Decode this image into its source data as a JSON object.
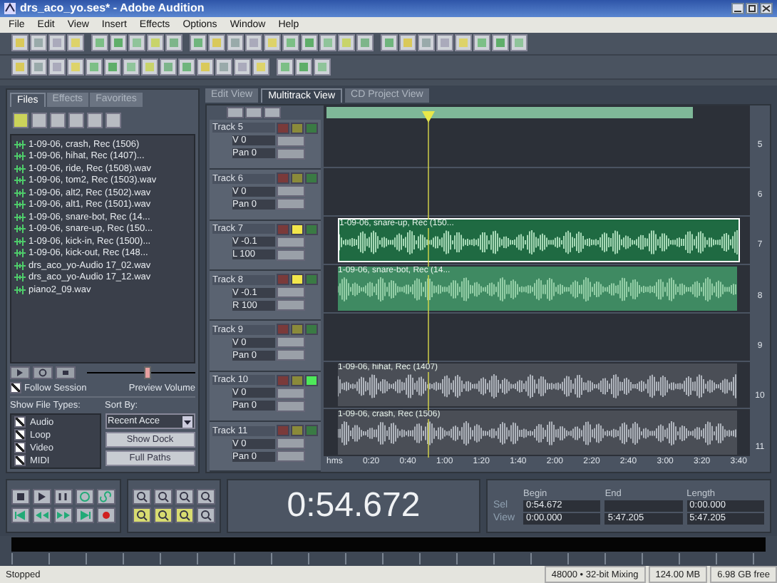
{
  "window": {
    "title": "drs_aco_yo.ses* - Adobe Audition"
  },
  "menu": [
    "File",
    "Edit",
    "View",
    "Insert",
    "Effects",
    "Options",
    "Window",
    "Help"
  ],
  "file_panel": {
    "tabs": [
      {
        "label": "Files",
        "selected": true
      },
      {
        "label": "Effects",
        "selected": false
      },
      {
        "label": "Favorites",
        "selected": false
      }
    ],
    "files": [
      "1-09-06, crash, Rec (1506)",
      "1-09-06, hihat, Rec (1407)...",
      "1-09-06, ride, Rec (1508).wav",
      "1-09-06, tom2, Rec (1503).wav",
      "1-09-06, alt2, Rec (1502).wav",
      "1-09-06, alt1, Rec (1501).wav",
      "1-09-06, snare-bot, Rec (14...",
      "1-09-06, snare-up, Rec (150...",
      "1-09-06, kick-in, Rec (1500)...",
      "1-09-06, kick-out, Rec (148...",
      "drs_aco_yo-Audio 17_02.wav",
      "drs_aco_yo-Audio 17_12.wav",
      "piano2_09.wav"
    ],
    "follow_session": {
      "label": "Follow Session",
      "checked": true
    },
    "preview_volume": {
      "label": "Preview Volume",
      "level": 0.55
    },
    "show_file_types": {
      "label": "Show File Types:",
      "types": [
        {
          "label": "Audio",
          "checked": true
        },
        {
          "label": "Loop",
          "checked": true
        },
        {
          "label": "Video",
          "checked": true
        },
        {
          "label": "MIDI",
          "checked": true
        }
      ]
    },
    "sort_by": {
      "label": "Sort By:",
      "value": "Recent Acce"
    },
    "buttons": [
      "Show Dock",
      "Full Paths"
    ]
  },
  "views": [
    {
      "label": "Edit View",
      "selected": false
    },
    {
      "label": "Multitrack View",
      "selected": true
    },
    {
      "label": "CD Project View",
      "selected": false
    }
  ],
  "tracks": [
    {
      "name": "Track 5",
      "number": "5",
      "mute": false,
      "solo": false,
      "record": false,
      "volume": "V 0",
      "pan": "Pan 0"
    },
    {
      "name": "Track 6",
      "number": "6",
      "mute": false,
      "solo": false,
      "record": false,
      "volume": "V 0",
      "pan": "Pan 0"
    },
    {
      "name": "Track 7",
      "number": "7",
      "mute": false,
      "solo": true,
      "record": false,
      "volume": "V -0.1",
      "pan": "L 100",
      "clip": {
        "label": "1-09-06, snare-up, Rec (150...",
        "selected": true
      }
    },
    {
      "name": "Track 8",
      "number": "8",
      "mute": false,
      "solo": true,
      "record": false,
      "volume": "V -0.1",
      "pan": "R 100",
      "clip": {
        "label": "1-09-06, snare-bot, Rec (14...",
        "selected": false
      }
    },
    {
      "name": "Track 9",
      "number": "9",
      "mute": false,
      "solo": false,
      "record": false,
      "volume": "V 0",
      "pan": "Pan 0"
    },
    {
      "name": "Track 10",
      "number": "10",
      "mute": false,
      "solo": false,
      "record": true,
      "volume": "V 0",
      "pan": "Pan 0",
      "clip": {
        "label": "1-09-06, hihat, Rec (1407)",
        "selected": false
      }
    },
    {
      "name": "Track 11",
      "number": "11",
      "mute": false,
      "solo": false,
      "record": false,
      "volume": "V 0",
      "pan": "Pan 0",
      "clip": {
        "label": "1-09-06, crash, Rec (1506)",
        "selected": false
      }
    }
  ],
  "ruler": [
    "hms",
    "0:20",
    "0:40",
    "1:00",
    "1:20",
    "1:40",
    "2:00",
    "2:20",
    "2:40",
    "3:00",
    "3:20",
    "3:40"
  ],
  "time": "0:54.672",
  "selection": {
    "headers": [
      "Begin",
      "End",
      "Length"
    ],
    "rows": [
      {
        "label": "Sel",
        "begin": "0:54.672",
        "length": "0:00.000"
      },
      {
        "label": "View",
        "begin": "0:00.000",
        "end": "5:47.205",
        "length": "5:47.205"
      }
    ]
  },
  "status": [
    "Stopped",
    "48000 • 32-bit Mixing",
    "124.00 MB",
    "6.98 GB free"
  ]
}
